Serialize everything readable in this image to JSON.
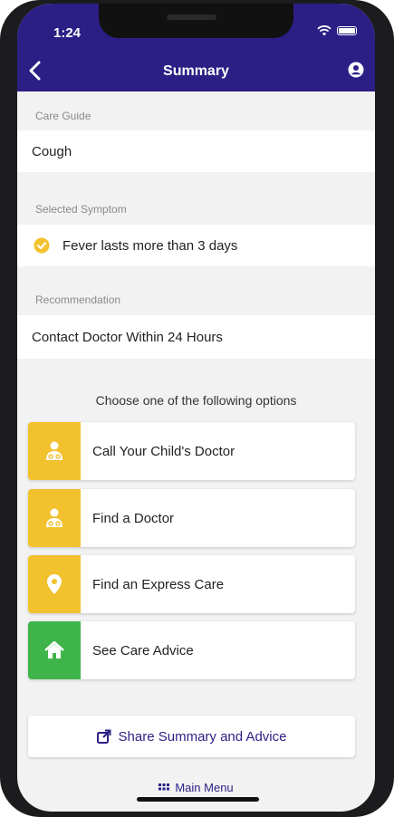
{
  "status_bar": {
    "time": "1:24"
  },
  "nav": {
    "title": "Summary",
    "back_icon": "chevron-left-icon",
    "profile_icon": "user-circle-icon"
  },
  "care_guide": {
    "label": "Care Guide",
    "value": "Cough"
  },
  "selected_symptom": {
    "label": "Selected Symptom",
    "value": "Fever lasts more than 3 days",
    "icon": "check-circle-icon"
  },
  "recommendation": {
    "label": "Recommendation",
    "value": "Contact Doctor Within 24 Hours"
  },
  "options": {
    "title": "Choose one of the following options",
    "items": [
      {
        "label": "Call Your Child's Doctor",
        "icon": "doctor-icon",
        "color": "#f2c12e"
      },
      {
        "label": "Find a Doctor",
        "icon": "doctor-icon",
        "color": "#f2c12e"
      },
      {
        "label": "Find an Express Care",
        "icon": "map-pin-icon",
        "color": "#f2c12e"
      },
      {
        "label": "See Care Advice",
        "icon": "home-icon",
        "color": "#3fb44a"
      }
    ]
  },
  "share": {
    "label": "Share Summary and Advice",
    "icon": "share-icon"
  },
  "main_menu": {
    "label": "Main Menu",
    "icon": "grid-icon"
  },
  "colors": {
    "header": "#2b1f86",
    "accent_yellow": "#f2c12e",
    "accent_green": "#3fb44a",
    "link": "#2b1f86"
  }
}
